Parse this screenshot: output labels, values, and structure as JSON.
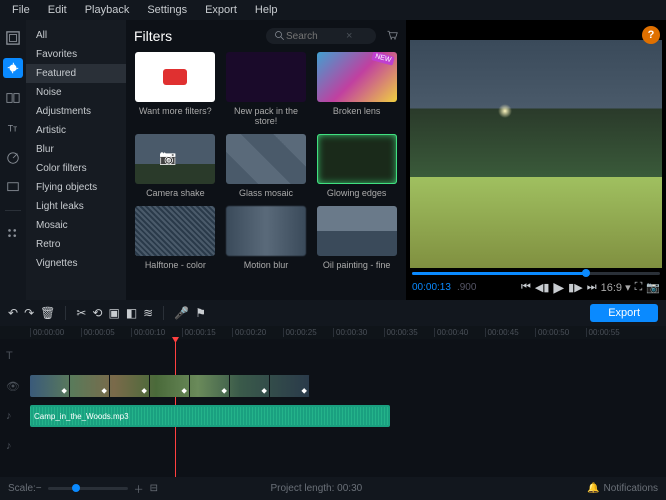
{
  "menu": {
    "items": [
      "File",
      "Edit",
      "Playback",
      "Settings",
      "Export",
      "Help"
    ]
  },
  "categories": [
    "All",
    "Favorites",
    "Featured",
    "Noise",
    "Adjustments",
    "Artistic",
    "Blur",
    "Color filters",
    "Flying objects",
    "Light leaks",
    "Mosaic",
    "Retro",
    "Vignettes"
  ],
  "cat_selected": 2,
  "panel": {
    "title": "Filters",
    "search_placeholder": "Search"
  },
  "filters": [
    {
      "label": "Want more filters?",
      "thumb": "t1"
    },
    {
      "label": "New pack in the store!",
      "thumb": "t2"
    },
    {
      "label": "Broken lens",
      "thumb": "t3",
      "badge": "NEW"
    },
    {
      "label": "Camera shake",
      "thumb": "t4"
    },
    {
      "label": "Glass mosaic",
      "thumb": "t5"
    },
    {
      "label": "Glowing edges",
      "thumb": "t6"
    },
    {
      "label": "Halftone - color",
      "thumb": "t7"
    },
    {
      "label": "Motion blur",
      "thumb": "t8"
    },
    {
      "label": "Oil painting - fine",
      "thumb": "t9"
    }
  ],
  "preview": {
    "tc": "00:00:13",
    "tc_frac": ".900",
    "aspect": "16:9"
  },
  "export_label": "Export",
  "ruler": [
    "00:00:00",
    "00:00:05",
    "00:00:10",
    "00:00:15",
    "00:00:20",
    "00:00:25",
    "00:00:30",
    "00:00:35",
    "00:00:40",
    "00:00:45",
    "00:00:50",
    "00:00:55"
  ],
  "audio_clip_name": "Camp_in_the_Woods.mp3",
  "footer": {
    "scale_label": "Scale:",
    "proj_len": "Project length: 00:30",
    "notif": "Notifications"
  }
}
